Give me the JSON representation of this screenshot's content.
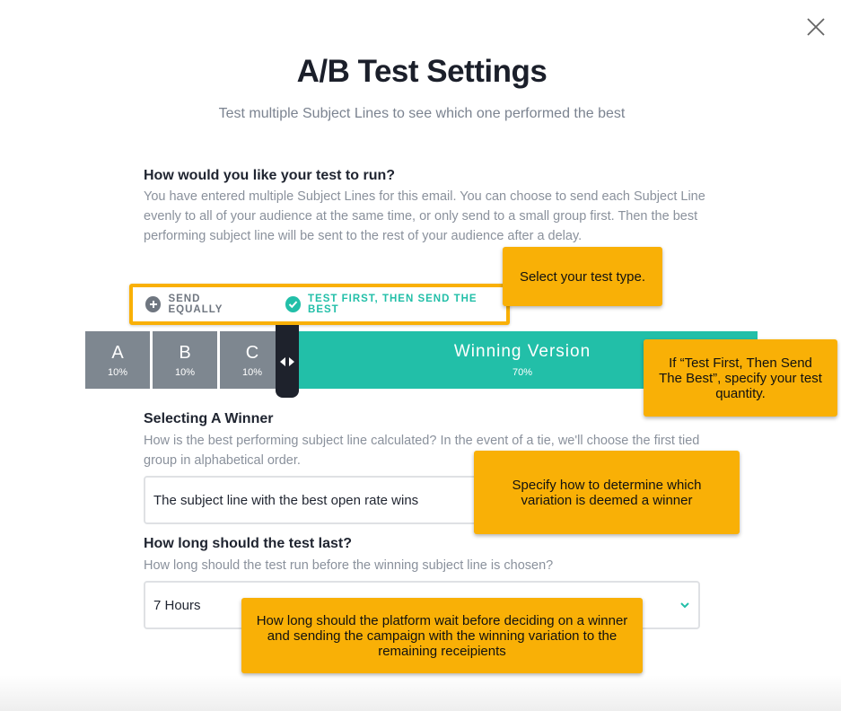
{
  "modal": {
    "title": "A/B Test Settings",
    "subtitle": "Test multiple Subject Lines to see which one performed the best",
    "close_icon": "close-icon"
  },
  "test_run": {
    "heading": "How would you like your test to run?",
    "description": "You have entered multiple Subject Lines for this email. You can choose to send each Subject Line evenly to all of your audience at the same time, or only send to a small group first. Then the best performing subject line will be sent to the rest of your audience after a delay.",
    "options": [
      {
        "label": "SEND EQUALLY",
        "selected": false,
        "icon": "plus-circle-icon"
      },
      {
        "label": "TEST FIRST, THEN SEND THE BEST",
        "selected": true,
        "icon": "check-circle-icon"
      }
    ]
  },
  "split": {
    "groups": [
      {
        "label": "A",
        "percent": "10%"
      },
      {
        "label": "B",
        "percent": "10%"
      },
      {
        "label": "C",
        "percent": "10%"
      }
    ],
    "winning": {
      "label": "Winning Version",
      "percent": "70%"
    },
    "handle_icon": "resize-handle-icon"
  },
  "winner": {
    "heading": "Selecting A Winner",
    "description": "How is the best performing subject line calculated? In the event of a tie, we'll choose the first tied group in alphabetical order.",
    "value": "The subject line with the best open rate wins"
  },
  "duration": {
    "heading": "How long should the test last?",
    "description": "How long should the test run before the winning subject line is chosen?",
    "value": "7 Hours"
  },
  "callouts": {
    "test_type": "Select your test type.",
    "quantity": "If “Test First, Then Send The Best”, specify your test quantity.",
    "winner": "Specify how to determine which variation is deemed a winner",
    "duration": "How long should the platform wait before deciding on a winner and sending the campaign with the winning variation to the remaining receipients"
  },
  "colors": {
    "accent": "#22bfa8",
    "callout": "#f9b006",
    "segment": "#7e8790",
    "handle": "#1e222c"
  }
}
